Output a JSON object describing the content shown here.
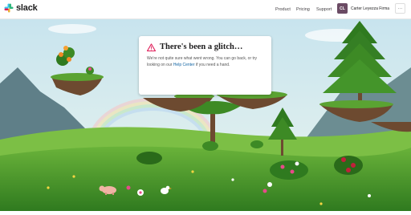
{
  "header": {
    "brand": "slack",
    "nav": [
      "Product",
      "Pricing",
      "Support"
    ],
    "avatar_initials": "CL",
    "user_name": "Carter Leyezza Firma",
    "more_label": "···"
  },
  "error": {
    "title": "There's been a glitch…",
    "message_before": "We're not quite sure what went wrong. You can go back, or try looking on our ",
    "help_link": "Help Center",
    "message_after": " if you need a hand."
  },
  "colors": {
    "sky_top": "#cfe7ef",
    "grass": "#3f8a24",
    "accent_link": "#1264a3",
    "warning": "#e01e5a"
  }
}
